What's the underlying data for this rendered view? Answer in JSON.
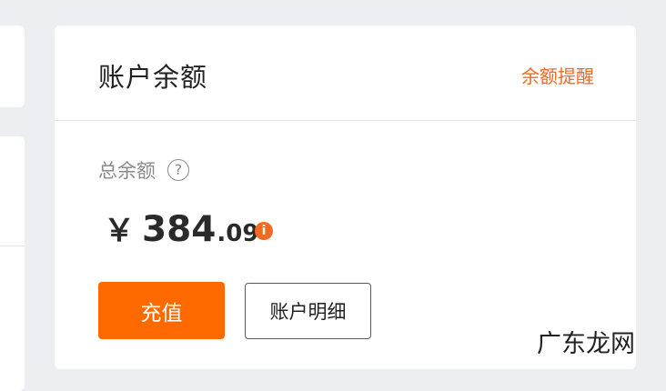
{
  "card": {
    "title": "账户余额",
    "alert_link": "余额提醒",
    "total_label": "总余额",
    "help_icon": "?",
    "currency": "￥",
    "amount_integer": "384",
    "amount_decimal": ".09",
    "info_icon": "i",
    "recharge_label": "充值",
    "details_label": "账户明细"
  },
  "watermark": "广东龙网",
  "colors": {
    "accent": "#ff6a00",
    "alert_text": "#f26a21",
    "page_background": "#edeef2"
  },
  "icons": [
    "help-circle-icon",
    "info-icon"
  ]
}
